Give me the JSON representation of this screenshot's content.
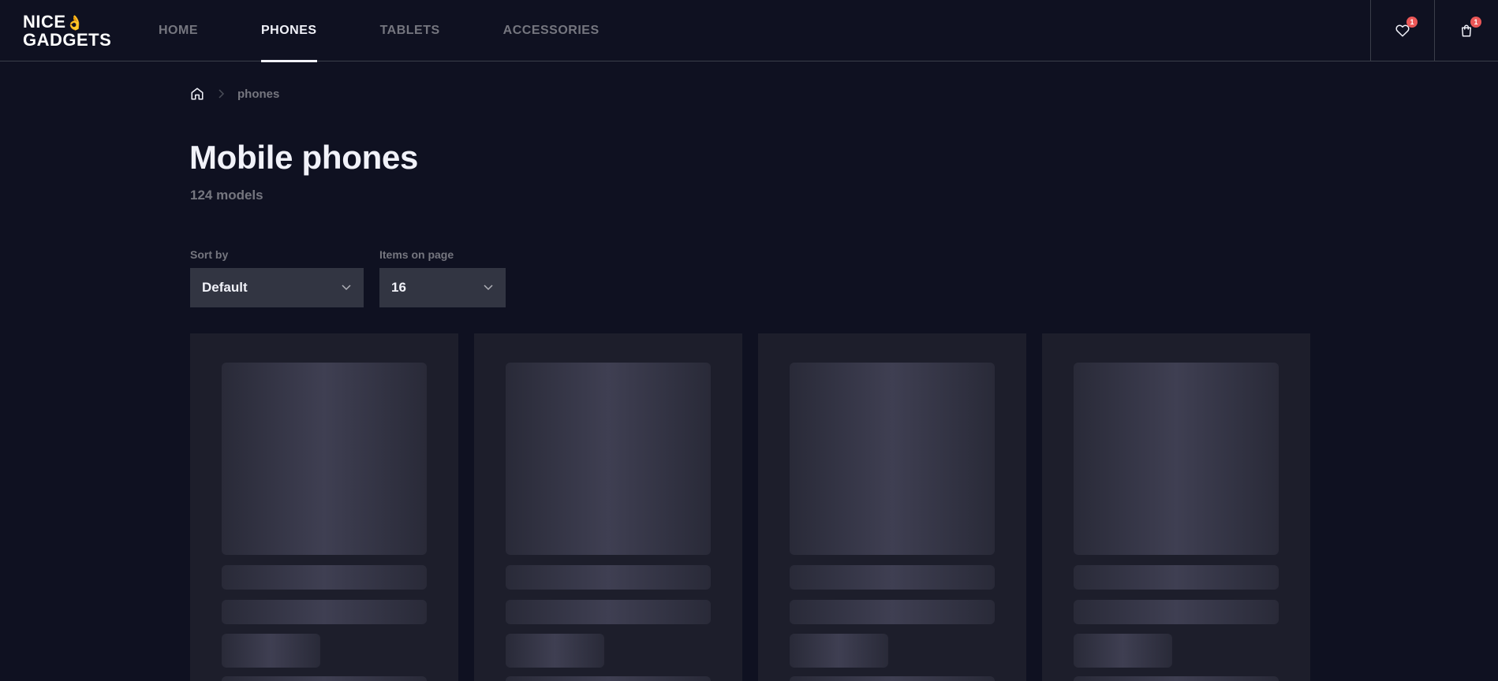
{
  "brand": {
    "line1": "NICE",
    "line2": "GADGETS",
    "emoji": "👌"
  },
  "nav": {
    "items": [
      {
        "label": "HOME",
        "active": false
      },
      {
        "label": "PHONES",
        "active": true
      },
      {
        "label": "TABLETS",
        "active": false
      },
      {
        "label": "ACCESSORIES",
        "active": false
      }
    ]
  },
  "header_actions": {
    "favorites": {
      "icon": "heart-icon",
      "count": "1"
    },
    "cart": {
      "icon": "shopping-bag-icon",
      "count": "1"
    }
  },
  "breadcrumb": {
    "home_icon": "home-icon",
    "current": "phones"
  },
  "page": {
    "title": "Mobile phones",
    "count": "124 models"
  },
  "filters": {
    "sort": {
      "label": "Sort by",
      "value": "Default"
    },
    "per_page": {
      "label": "Items on page",
      "value": "16"
    }
  },
  "colors": {
    "background": "#0f1121",
    "surface": "#1d1e2b",
    "select_bg": "#323542",
    "accent_badge": "#eb5757",
    "text_primary": "#f1f2f9",
    "text_secondary": "#75767f"
  },
  "cards": {
    "loading": true,
    "skeleton_count": 4
  }
}
